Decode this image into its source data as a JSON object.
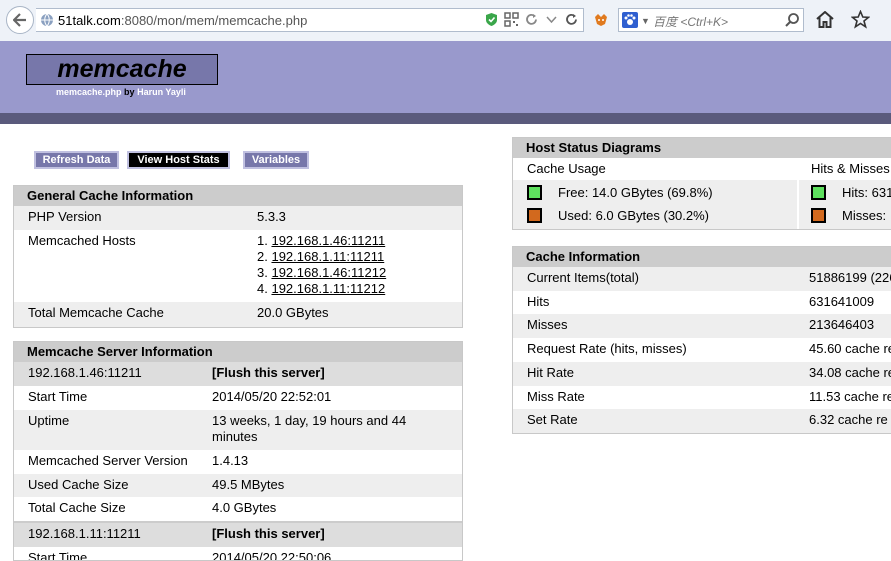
{
  "browser": {
    "url_host": "51talk.com",
    "url_rest": ":8080/mon/mem/memcache.php",
    "search_placeholder": "百度 <Ctrl+K>"
  },
  "header": {
    "title": "memcache",
    "subtitle_file": "memcache.php",
    "subtitle_by": "by",
    "subtitle_author": "Harun Yayli"
  },
  "menu": {
    "refresh": "Refresh Data",
    "view_host_stats": "View Host Stats",
    "variables": "Variables"
  },
  "general": {
    "title": "General Cache Information",
    "php_label": "PHP Version",
    "php_value": "5.3.3",
    "hosts_label": "Memcached Hosts",
    "hosts": [
      {
        "num": "1.",
        "addr": "192.168.1.46:11211"
      },
      {
        "num": "2.",
        "addr": "192.168.1.11:11211"
      },
      {
        "num": "3.",
        "addr": "192.168.1.46:11212"
      },
      {
        "num": "4.",
        "addr": "192.168.1.11:11212"
      }
    ],
    "total_label": "Total Memcache Cache",
    "total_value": "20.0 GBytes"
  },
  "server": {
    "title": "Memcache Server Information",
    "flush_label": "[Flush this server]",
    "s1": {
      "host": "192.168.1.46:11211",
      "start_label": "Start Time",
      "start_value": "2014/05/20 22:52:01",
      "uptime_label": "Uptime",
      "uptime_value_1": "13 weeks, 1 day, 19 hours and 44",
      "uptime_value_2": "minutes",
      "version_label": "Memcached Server Version",
      "version_value": "1.4.13",
      "used_label": "Used Cache Size",
      "used_value": "49.5 MBytes",
      "total_label": "Total Cache Size",
      "total_value": "4.0 GBytes"
    },
    "s2": {
      "host": "192.168.1.11:11211",
      "start_label": "Start Time",
      "start_value": "2014/05/20 22:50:06"
    }
  },
  "diagrams": {
    "title": "Host Status Diagrams",
    "cache_usage": "Cache Usage",
    "free": "Free: 14.0 GBytes (69.8%)",
    "used": "Used: 6.0 GBytes (30.2%)",
    "hits_misses": "Hits & Misses",
    "hits": "Hits: 631",
    "misses": "Misses:",
    "free_color": "#5ee05e",
    "used_color": "#d2691e"
  },
  "cache_info": {
    "title": "Cache Information",
    "rows": [
      {
        "label": "Current Items(total)",
        "value": "51886199 (226"
      },
      {
        "label": "Hits",
        "value": "631641009"
      },
      {
        "label": "Misses",
        "value": "213646403"
      },
      {
        "label": "Request Rate (hits, misses)",
        "value": "45.60 cache re"
      },
      {
        "label": "Hit Rate",
        "value": "34.08 cache re"
      },
      {
        "label": "Miss Rate",
        "value": "11.53 cache re"
      },
      {
        "label": "Set Rate",
        "value": "6.32 cache re"
      }
    ]
  }
}
